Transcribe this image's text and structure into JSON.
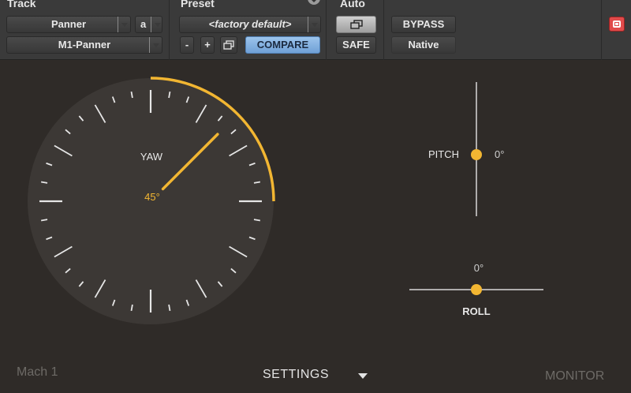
{
  "header": {
    "track": {
      "title": "Track",
      "plugin_name": "Panner",
      "insert_letter": "a",
      "track_name": "M1-Panner"
    },
    "preset": {
      "title": "Preset",
      "preset_name": "<factory default>",
      "minus_label": "-",
      "plus_label": "+",
      "compare_label": "COMPARE"
    },
    "auto": {
      "title": "Auto",
      "safe_label": "SAFE"
    },
    "bypass_label": "BYPASS",
    "native_label": "Native"
  },
  "panner": {
    "yaw_label": "YAW",
    "yaw_value": "45°",
    "yaw_degrees": 45,
    "pitch_label": "PITCH",
    "pitch_value": "0°",
    "pitch_degrees": 0,
    "roll_label": "ROLL",
    "roll_value": "0°",
    "roll_degrees": 0
  },
  "footer": {
    "brand": "Mach 1",
    "settings_label": "SETTINGS",
    "monitor_label": "MONITOR"
  },
  "colors": {
    "accent": "#f2b632",
    "background": "#2f2b28",
    "dial_face": "#3c3835",
    "header": "#3a3a3a"
  }
}
